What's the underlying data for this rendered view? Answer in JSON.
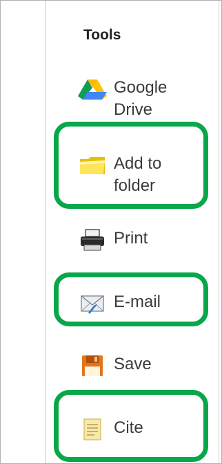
{
  "panel": {
    "title": "Tools",
    "items": [
      {
        "id": "google-drive",
        "label_line1": "Google",
        "label_line2": "Drive",
        "icon": "google-drive-icon"
      },
      {
        "id": "add-to-folder",
        "label_line1": "Add to",
        "label_line2": "folder",
        "icon": "folder-icon"
      },
      {
        "id": "print",
        "label_line1": "Print",
        "icon": "printer-icon"
      },
      {
        "id": "email",
        "label_line1": "E-mail",
        "icon": "envelope-icon"
      },
      {
        "id": "save",
        "label_line1": "Save",
        "icon": "floppy-disk-icon"
      },
      {
        "id": "cite",
        "label_line1": "Cite",
        "icon": "document-icon"
      }
    ]
  },
  "colors": {
    "highlight": "#0aa74a",
    "text": "#3a3a3a",
    "title": "#222222"
  }
}
